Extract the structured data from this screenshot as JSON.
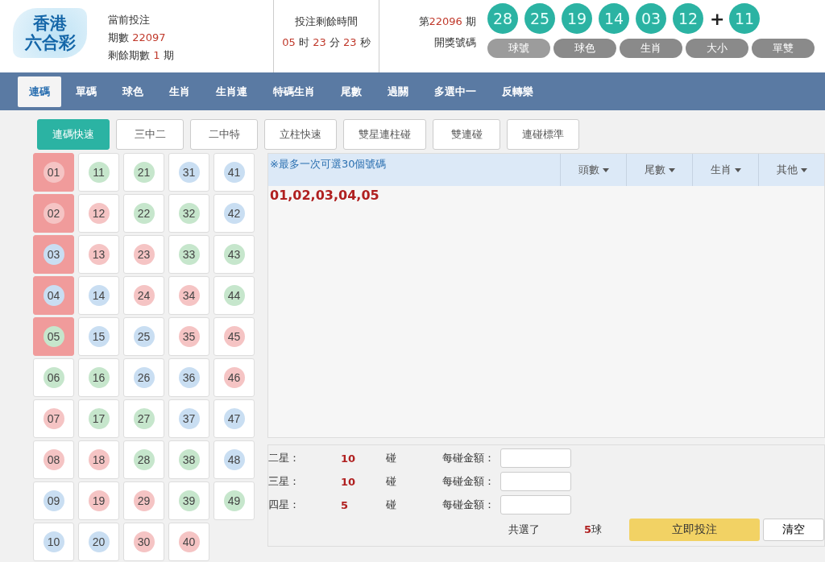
{
  "logo": {
    "line1": "香港",
    "line2": "六合彩"
  },
  "current": {
    "label": "當前投注",
    "period_label": "期數",
    "period": "22097",
    "remain_label": "剩餘期數",
    "remain": "1",
    "remain_unit": "期"
  },
  "countdown": {
    "label": "投注剩餘時間",
    "hours": "05",
    "h_unit": "时",
    "minutes": "23",
    "m_unit": "分",
    "seconds": "23",
    "s_unit": "秒"
  },
  "last_draw": {
    "prefix": "第",
    "period": "22096",
    "suffix": "期",
    "label": "開獎號碼",
    "balls": [
      "28",
      "25",
      "19",
      "14",
      "03",
      "12"
    ],
    "plus": "+",
    "special": "11"
  },
  "draw_tabs": [
    {
      "label": "球號",
      "selected": true
    },
    {
      "label": "球色",
      "selected": false
    },
    {
      "label": "生肖",
      "selected": false
    },
    {
      "label": "大小",
      "selected": false
    },
    {
      "label": "單雙",
      "selected": false
    }
  ],
  "nav": [
    {
      "label": "連碼",
      "selected": true
    },
    {
      "label": "單碼",
      "selected": false
    },
    {
      "label": "球色",
      "selected": false
    },
    {
      "label": "生肖",
      "selected": false
    },
    {
      "label": "生肖連",
      "selected": false
    },
    {
      "label": "特碼生肖",
      "selected": false
    },
    {
      "label": "尾數",
      "selected": false
    },
    {
      "label": "過關",
      "selected": false
    },
    {
      "label": "多選中一",
      "selected": false
    },
    {
      "label": "反轉樂",
      "selected": false
    }
  ],
  "sub_tabs": [
    {
      "label": "連碼快速",
      "selected": true
    },
    {
      "label": "三中二",
      "selected": false
    },
    {
      "label": "二中特",
      "selected": false
    },
    {
      "label": "立柱快速",
      "selected": false
    },
    {
      "label": "雙星連柱碰",
      "selected": false
    },
    {
      "label": "雙連碰",
      "selected": false
    },
    {
      "label": "連碰標準",
      "selected": false
    }
  ],
  "numbers": [
    {
      "n": "01",
      "color": "#f5c4c4",
      "selected": true
    },
    {
      "n": "02",
      "color": "#f5c4c4",
      "selected": true
    },
    {
      "n": "03",
      "color": "#c9def2",
      "selected": true
    },
    {
      "n": "04",
      "color": "#c9def2",
      "selected": true
    },
    {
      "n": "05",
      "color": "#c6e6cc",
      "selected": true
    },
    {
      "n": "06",
      "color": "#c6e6cc",
      "selected": false
    },
    {
      "n": "07",
      "color": "#f5c4c4",
      "selected": false
    },
    {
      "n": "08",
      "color": "#f5c4c4",
      "selected": false
    },
    {
      "n": "09",
      "color": "#c9def2",
      "selected": false
    },
    {
      "n": "10",
      "color": "#c9def2",
      "selected": false
    },
    {
      "n": "11",
      "color": "#c6e6cc",
      "selected": false
    },
    {
      "n": "12",
      "color": "#f5c4c4",
      "selected": false
    },
    {
      "n": "13",
      "color": "#f5c4c4",
      "selected": false
    },
    {
      "n": "14",
      "color": "#c9def2",
      "selected": false
    },
    {
      "n": "15",
      "color": "#c9def2",
      "selected": false
    },
    {
      "n": "16",
      "color": "#c6e6cc",
      "selected": false
    },
    {
      "n": "17",
      "color": "#c6e6cc",
      "selected": false
    },
    {
      "n": "18",
      "color": "#f5c4c4",
      "selected": false
    },
    {
      "n": "19",
      "color": "#f5c4c4",
      "selected": false
    },
    {
      "n": "20",
      "color": "#c9def2",
      "selected": false
    },
    {
      "n": "21",
      "color": "#c6e6cc",
      "selected": false
    },
    {
      "n": "22",
      "color": "#c6e6cc",
      "selected": false
    },
    {
      "n": "23",
      "color": "#f5c4c4",
      "selected": false
    },
    {
      "n": "24",
      "color": "#f5c4c4",
      "selected": false
    },
    {
      "n": "25",
      "color": "#c9def2",
      "selected": false
    },
    {
      "n": "26",
      "color": "#c9def2",
      "selected": false
    },
    {
      "n": "27",
      "color": "#c6e6cc",
      "selected": false
    },
    {
      "n": "28",
      "color": "#c6e6cc",
      "selected": false
    },
    {
      "n": "29",
      "color": "#f5c4c4",
      "selected": false
    },
    {
      "n": "30",
      "color": "#f5c4c4",
      "selected": false
    },
    {
      "n": "31",
      "color": "#c9def2",
      "selected": false
    },
    {
      "n": "32",
      "color": "#c6e6cc",
      "selected": false
    },
    {
      "n": "33",
      "color": "#c6e6cc",
      "selected": false
    },
    {
      "n": "34",
      "color": "#f5c4c4",
      "selected": false
    },
    {
      "n": "35",
      "color": "#f5c4c4",
      "selected": false
    },
    {
      "n": "36",
      "color": "#c9def2",
      "selected": false
    },
    {
      "n": "37",
      "color": "#c9def2",
      "selected": false
    },
    {
      "n": "38",
      "color": "#c6e6cc",
      "selected": false
    },
    {
      "n": "39",
      "color": "#c6e6cc",
      "selected": false
    },
    {
      "n": "40",
      "color": "#f5c4c4",
      "selected": false
    },
    {
      "n": "41",
      "color": "#c9def2",
      "selected": false
    },
    {
      "n": "42",
      "color": "#c9def2",
      "selected": false
    },
    {
      "n": "43",
      "color": "#c6e6cc",
      "selected": false
    },
    {
      "n": "44",
      "color": "#c6e6cc",
      "selected": false
    },
    {
      "n": "45",
      "color": "#f5c4c4",
      "selected": false
    },
    {
      "n": "46",
      "color": "#f5c4c4",
      "selected": false
    },
    {
      "n": "47",
      "color": "#c9def2",
      "selected": false
    },
    {
      "n": "48",
      "color": "#c9def2",
      "selected": false
    },
    {
      "n": "49",
      "color": "#c6e6cc",
      "selected": false
    }
  ],
  "panel": {
    "note": "※最多一次可選30個號碼",
    "filters": [
      "頭數",
      "尾數",
      "生肖",
      "其他"
    ],
    "selection": "01,02,03,04,05"
  },
  "bets": [
    {
      "label": "二星：",
      "count": "10",
      "unit": "碰",
      "amount_label": "每碰金額："
    },
    {
      "label": "三星：",
      "count": "10",
      "unit": "碰",
      "amount_label": "每碰金額："
    },
    {
      "label": "四星：",
      "count": "5",
      "unit": "碰",
      "amount_label": "每碰金額："
    }
  ],
  "summary": {
    "label": "共選了",
    "count": "5",
    "unit": "球",
    "submit": "立即投注",
    "clear": "清空"
  }
}
